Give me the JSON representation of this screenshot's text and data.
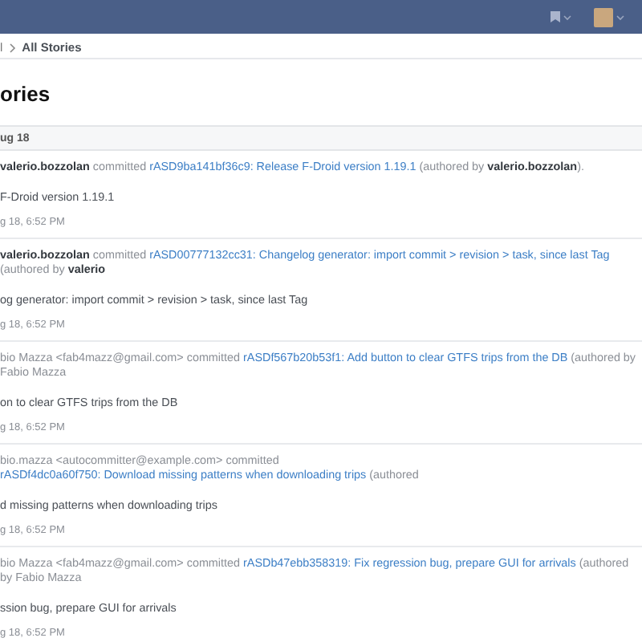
{
  "navbar": {
    "menus": [
      {
        "kind": "bookmark"
      },
      {
        "kind": "avatar"
      }
    ]
  },
  "breadcrumbs": [
    {
      "label": "l",
      "selected": false
    },
    {
      "label": "All Stories",
      "selected": true
    }
  ],
  "page_title": "ories",
  "date_header": "ug 18",
  "stories": [
    {
      "byline": "**valerio.bozzolan** committed",
      "link": "rASD9ba141bf36c9: Release F-Droid version 1.19.1",
      "after": "(authored by **valerio.bozzolan**).",
      "body": "F-Droid version 1.19.1",
      "date": "g 18, 6:52 PM"
    },
    {
      "byline": "**valerio.bozzolan** committed",
      "link": "rASD00777132cc31: Changelog generator: import commit > revision > task, since last Tag",
      "after": "(authored by **valerio**",
      "body": "og generator: import commit > revision > task, since last Tag",
      "date": "g 18, 6:52 PM"
    },
    {
      "byline": "bio Mazza <fab4mazz@gmail.com> committed",
      "link": "rASDf567b20b53f1: Add button to clear GTFS trips from the DB",
      "after": "(authored by Fabio Mazza",
      "body": "on to clear GTFS trips from the DB",
      "date": "g 18, 6:52 PM"
    },
    {
      "byline": "bio.mazza <autocommitter@example.com> committed",
      "link": "rASDf4dc0a60f750: Download missing patterns when downloading trips",
      "after": "(authored",
      "body": "d missing patterns when downloading trips",
      "date": "g 18, 6:52 PM"
    },
    {
      "byline": "bio Mazza <fab4mazz@gmail.com> committed",
      "link": "rASDb47ebb358319: Fix regression bug, prepare GUI for arrivals",
      "after": "(authored by Fabio Mazza",
      "body": "ssion bug, prepare GUI for arrivals",
      "date": "g 18, 6:52 PM"
    }
  ]
}
